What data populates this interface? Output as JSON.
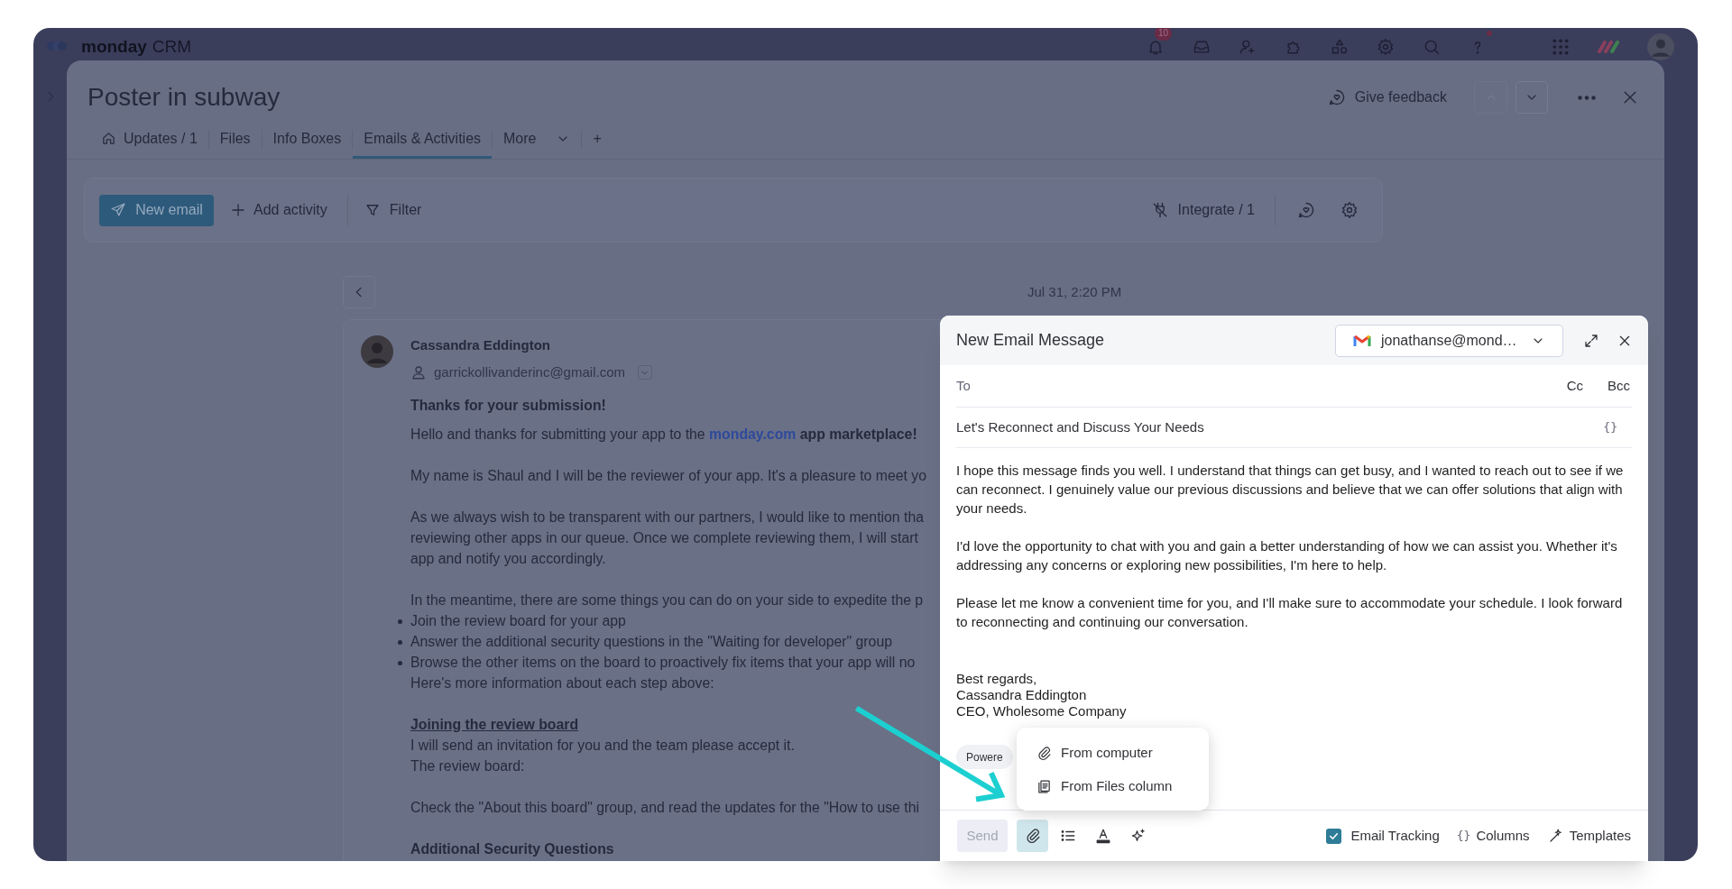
{
  "app_bar": {
    "logo": "monday",
    "product": "CRM",
    "notification_count": "10"
  },
  "item": {
    "title": "Poster in subway",
    "give_feedback": "Give feedback",
    "tabs": [
      {
        "label": "Updates / 1",
        "kind": "home",
        "selected": false
      },
      {
        "label": "Files",
        "kind": "plain",
        "selected": false
      },
      {
        "label": "Info Boxes",
        "kind": "plain",
        "selected": false
      },
      {
        "label": "Emails & Activities",
        "kind": "plain",
        "selected": true
      },
      {
        "label": "More",
        "kind": "more",
        "selected": false
      },
      {
        "label": "+",
        "kind": "add",
        "selected": false
      }
    ]
  },
  "toolbar": {
    "new_email": "New email",
    "add_activity": "Add activity",
    "filter": "Filter",
    "integrate": "Integrate / 1"
  },
  "timeline": {
    "date": "Jul 31, 2:20 PM"
  },
  "email": {
    "sender": "Cassandra Eddington",
    "address": "garrickollivanderinc@gmail.com",
    "blocks": [
      {
        "lines": [
          {
            "kind": "bold",
            "text": "Thanks for your submission!"
          },
          {
            "kind": "parts",
            "parts": [
              {
                "kind": "plain",
                "text": "Hello and thanks for submitting your app to the "
              },
              {
                "kind": "link",
                "text": "monday.com"
              },
              {
                "kind": "bold",
                "text": " app marketplace!"
              }
            ]
          }
        ]
      },
      {
        "lines": [
          {
            "kind": "text",
            "text": "My name is Shaul and I will be the reviewer of your app. It's a pleasure to meet yo"
          }
        ]
      },
      {
        "lines": [
          {
            "kind": "text",
            "text": "As we always wish to be transparent with our partners, I would like to mention tha"
          },
          {
            "kind": "text",
            "text": "reviewing other apps in our queue. Once we complete reviewing them, I will start"
          },
          {
            "kind": "text",
            "text": "app and notify you accordingly."
          }
        ]
      },
      {
        "lines": [
          {
            "kind": "text",
            "text": "In the meantime, there are some things you can do on your side to expedite the p"
          },
          {
            "kind": "bullet",
            "text": "Join the review board for your app"
          },
          {
            "kind": "bullet",
            "text": "Answer the additional security questions in the \"Waiting for developer\" group"
          },
          {
            "kind": "bullet",
            "text": "Browse the other items on the board to proactively fix items that your app will no"
          },
          {
            "kind": "text",
            "text": "Here's more information about each step above:"
          }
        ]
      },
      {
        "lines": [
          {
            "kind": "underline",
            "text": "Joining the review board"
          },
          {
            "kind": "text",
            "text": "I will send an invitation for you and the team please accept it."
          },
          {
            "kind": "text",
            "text": "The review board:"
          }
        ]
      },
      {
        "lines": [
          {
            "kind": "text",
            "text": "Check the \"About this board\" group, and read the updates for the \"How to use thi"
          }
        ]
      },
      {
        "lines": [
          {
            "kind": "bold",
            "text": "Additional Security Questions"
          }
        ]
      }
    ]
  },
  "compose": {
    "title": "New Email Message",
    "account": "jonathanse@mond…",
    "to_label": "To",
    "cc": "Cc",
    "bcc": "Bcc",
    "subject": "Let's Reconnect and Discuss Your Needs",
    "variables": "{}",
    "body": [
      "I hope this message finds you well. I understand that things can get busy, and I wanted to reach out to see if we can reconnect. I genuinely value our previous discussions and believe that we can offer solutions that align with your needs.",
      "I'd love the opportunity to chat with you and gain a better understanding of how we can assist you. Whether it's addressing any concerns or exploring new possibilities, I'm here to help.",
      "Please let me know a convenient time for you, and I'll make sure to accommodate your schedule. I look forward to reconnecting and continuing our conversation."
    ],
    "signature": [
      "Best regards,",
      "Cassandra Eddington",
      "CEO, Wholesome Company"
    ],
    "powered_chip": "Powere",
    "send": {
      "label": "Send",
      "disabled": true
    },
    "tools": [
      {
        "kind": "attach",
        "selected": true
      },
      {
        "kind": "list",
        "selected": false
      },
      {
        "kind": "text_color",
        "selected": false
      },
      {
        "kind": "ai",
        "selected": false
      }
    ],
    "email_tracking": {
      "label": "Email Tracking",
      "checked": true
    },
    "columns": {
      "glyph": "{}",
      "label": "Columns"
    },
    "templates": "Templates"
  },
  "attach_menu": {
    "items": [
      {
        "kind": "computer",
        "label": "From computer"
      },
      {
        "kind": "files",
        "label": "From Files column"
      }
    ]
  }
}
